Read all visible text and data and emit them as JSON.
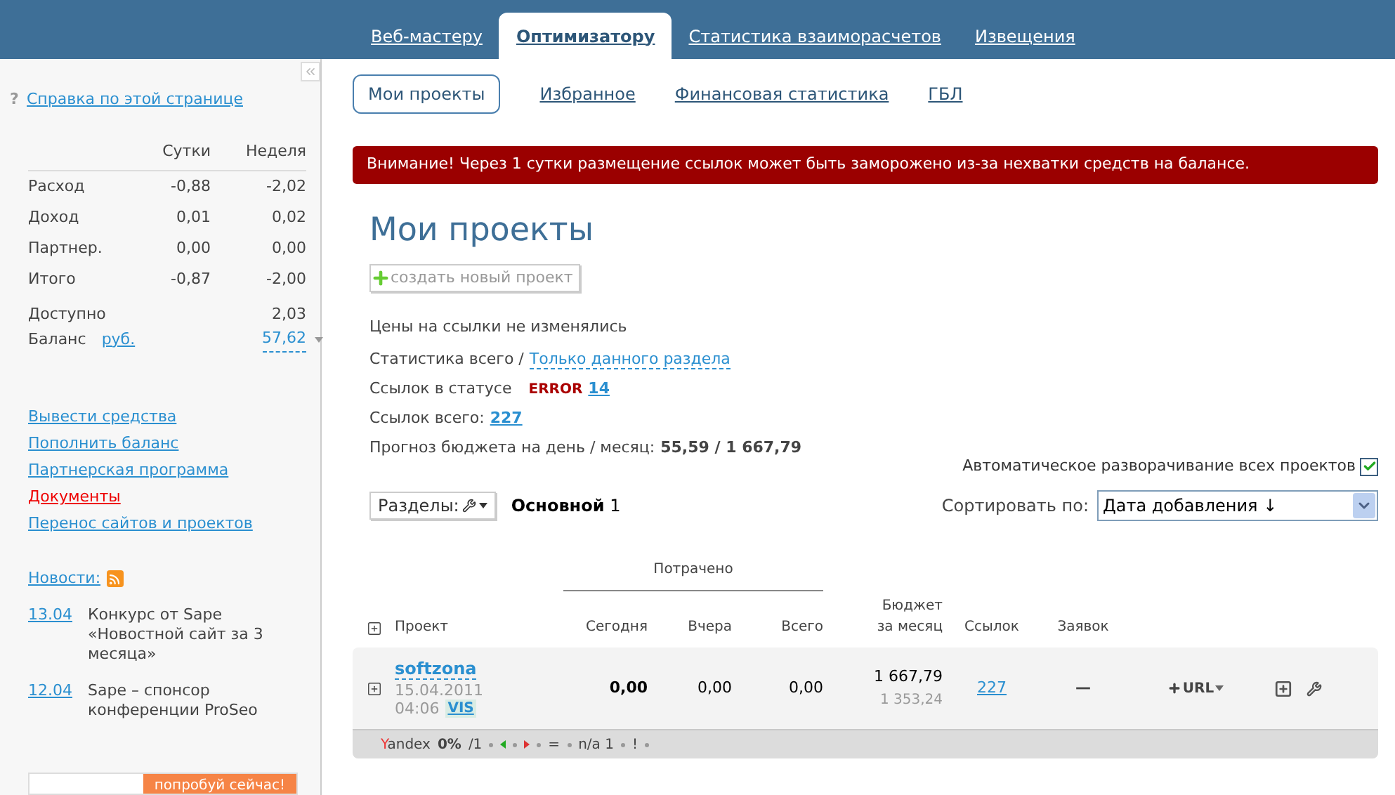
{
  "top_tabs": [
    {
      "label": "Веб-мастеру",
      "selected": false
    },
    {
      "label": "Оптимизатору",
      "selected": true
    },
    {
      "label": "Статистика взаиморасчетов",
      "selected": false
    },
    {
      "label": "Извещения",
      "selected": false
    }
  ],
  "sidebar": {
    "help_mark": "?",
    "help_link": "Справка по этой странице",
    "stats": {
      "columns": [
        "Сутки",
        "Неделя"
      ],
      "rows": [
        {
          "label": "Расход",
          "day": "-0,88",
          "week": "-2,02"
        },
        {
          "label": "Доход",
          "day": "0,01",
          "week": "0,02"
        },
        {
          "label": "Партнер.",
          "day": "0,00",
          "week": "0,00"
        },
        {
          "label": "Итого",
          "day": "-0,87",
          "week": "-2,00"
        }
      ],
      "available": {
        "label": "Доступно",
        "value": "2,03"
      },
      "balance": {
        "label": "Баланс",
        "currency": "руб.",
        "value": "57,62"
      }
    },
    "links": [
      {
        "label": "Вывести средства",
        "kind": "link"
      },
      {
        "label": "Пополнить баланс",
        "kind": "link"
      },
      {
        "label": "Партнерская программа",
        "kind": "link"
      },
      {
        "label": "Документы",
        "kind": "alert"
      },
      {
        "label": "Перенос сайтов и проектов",
        "kind": "link"
      }
    ],
    "news": {
      "title": "Новости:",
      "items": [
        {
          "date": "13.04",
          "text": "Конкурс от Sape «Новостной сайт за 3 месяца»"
        },
        {
          "date": "12.04",
          "text": "Sape – спонсор конференции ProSeo"
        }
      ]
    },
    "promo": {
      "label": "попробуй сейчас!"
    }
  },
  "sub_tabs": [
    {
      "label": "Мои проекты",
      "selected": true
    },
    {
      "label": "Избранное",
      "selected": false
    },
    {
      "label": "Финансовая статистика",
      "selected": false
    },
    {
      "label": "ГБЛ",
      "selected": false
    }
  ],
  "alert": "Внимание! Через 1 сутки размещение ссылок может быть заморожено из-за нехватки средств на балансе.",
  "page_title": "Мои проекты",
  "create_button": "создать новый проект",
  "info": {
    "prices_note": "Цены на ссылки не изменялись",
    "stats_label": "Статистика всего /",
    "stats_link": "Только данного раздела",
    "status_label": "Ссылок в статусе",
    "status_value": "ERROR",
    "status_count": "14",
    "links_label": "Ссылок всего:",
    "links_count": "227",
    "forecast_label": "Прогноз бюджета на день / месяц:",
    "forecast_value": "55,59 / 1 667,79"
  },
  "auto_expand": {
    "label": "Автоматическое разворачивание всех проектов",
    "checked": true
  },
  "sections": {
    "button": "Разделы:",
    "current": "Основной",
    "count": "1"
  },
  "sort": {
    "label": "Сортировать по:",
    "value": "Дата добавления ↓"
  },
  "table": {
    "group_header": "Потрачено",
    "columns": [
      "Проект",
      "Сегодня",
      "Вчера",
      "Всего",
      "Бюджет\nза месяц",
      "Ссылок",
      "Заявок"
    ],
    "rows": [
      {
        "name": "softzona",
        "date": "15.04.2011",
        "time": "04:06",
        "badge": "VIS",
        "today": "0,00",
        "yesterday": "0,00",
        "total": "0,00",
        "budget": "1 667,79",
        "budget_sub": "1 353,24",
        "links": "227",
        "requests": "—",
        "url_button": "URL",
        "footer": {
          "engine": "Yandex",
          "percent": "0%",
          "count": "/1",
          "items": [
            "=",
            "n/a 1",
            "!"
          ]
        }
      }
    ]
  }
}
